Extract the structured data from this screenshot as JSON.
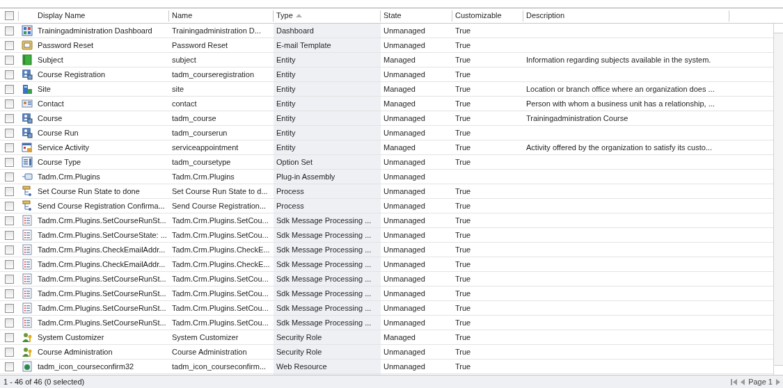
{
  "columns": [
    {
      "label": "Display Name",
      "sorted": false
    },
    {
      "label": "Name",
      "sorted": false
    },
    {
      "label": "Type",
      "sorted": true
    },
    {
      "label": "State",
      "sorted": false
    },
    {
      "label": "Customizable",
      "sorted": false
    },
    {
      "label": "Description",
      "sorted": false
    }
  ],
  "select_all": {
    "checked": false
  },
  "rows": [
    {
      "checked": false,
      "kind": "dashboard",
      "display_name": "Trainingadministration Dashboard",
      "name": "Trainingadministration D...",
      "type": "Dashboard",
      "state": "Unmanaged",
      "customizable": "True"
    },
    {
      "checked": false,
      "kind": "template",
      "display_name": "Password Reset",
      "name": "Password Reset",
      "type": "E-mail Template",
      "state": "Unmanaged",
      "customizable": "True"
    },
    {
      "checked": false,
      "kind": "book",
      "display_name": "Subject",
      "name": "subject",
      "type": "Entity",
      "state": "Managed",
      "customizable": "True",
      "description": "Information regarding subjects available in the system."
    },
    {
      "checked": false,
      "kind": "entity",
      "display_name": "Course Registration",
      "name": "tadm_courseregistration",
      "type": "Entity",
      "state": "Unmanaged",
      "customizable": "True"
    },
    {
      "checked": false,
      "kind": "building",
      "display_name": "Site",
      "name": "site",
      "type": "Entity",
      "state": "Managed",
      "customizable": "True",
      "description": "Location or branch office where an organization does ..."
    },
    {
      "checked": false,
      "kind": "card",
      "display_name": "Contact",
      "name": "contact",
      "type": "Entity",
      "state": "Managed",
      "customizable": "True",
      "description": "Person with whom a business unit has a relationship, ..."
    },
    {
      "checked": false,
      "kind": "entity",
      "display_name": "Course",
      "name": "tadm_course",
      "type": "Entity",
      "state": "Unmanaged",
      "customizable": "True",
      "description": "Trainingadministration Course"
    },
    {
      "checked": false,
      "kind": "entity",
      "display_name": "Course Run",
      "name": "tadm_courserun",
      "type": "Entity",
      "state": "Unmanaged",
      "customizable": "True"
    },
    {
      "checked": false,
      "kind": "calendar",
      "display_name": "Service Activity",
      "name": "serviceappointment",
      "type": "Entity",
      "state": "Managed",
      "customizable": "True",
      "description": "Activity offered by the organization to satisfy its custo..."
    },
    {
      "checked": false,
      "kind": "list",
      "display_name": "Course Type",
      "name": "tadm_coursetype",
      "type": "Option Set",
      "state": "Unmanaged",
      "customizable": "True"
    },
    {
      "checked": false,
      "kind": "plug",
      "display_name": "Tadm.Crm.Plugins",
      "name": "Tadm.Crm.Plugins",
      "type": "Plug-in Assembly",
      "state": "Unmanaged"
    },
    {
      "checked": false,
      "kind": "flow",
      "display_name": "Set Course Run State to done",
      "name": "Set Course Run State to d...",
      "type": "Process",
      "state": "Unmanaged",
      "customizable": "True"
    },
    {
      "checked": false,
      "kind": "flow",
      "display_name": "Send Course Registration Confirma...",
      "name": "Send Course Registration...",
      "type": "Process",
      "state": "Unmanaged",
      "customizable": "True"
    },
    {
      "checked": false,
      "kind": "doc",
      "display_name": "Tadm.Crm.Plugins.SetCourseRunSt...",
      "name": "Tadm.Crm.Plugins.SetCou...",
      "type": "Sdk Message Processing ...",
      "state": "Unmanaged",
      "customizable": "True"
    },
    {
      "checked": false,
      "kind": "doc",
      "display_name": "Tadm.Crm.Plugins.SetCourseState: ...",
      "name": "Tadm.Crm.Plugins.SetCou...",
      "type": "Sdk Message Processing ...",
      "state": "Unmanaged",
      "customizable": "True"
    },
    {
      "checked": false,
      "kind": "doc",
      "display_name": "Tadm.Crm.Plugins.CheckEmailAddr...",
      "name": "Tadm.Crm.Plugins.CheckE...",
      "type": "Sdk Message Processing ...",
      "state": "Unmanaged",
      "customizable": "True"
    },
    {
      "checked": false,
      "kind": "doc",
      "display_name": "Tadm.Crm.Plugins.CheckEmailAddr...",
      "name": "Tadm.Crm.Plugins.CheckE...",
      "type": "Sdk Message Processing ...",
      "state": "Unmanaged",
      "customizable": "True"
    },
    {
      "checked": false,
      "kind": "doc",
      "display_name": "Tadm.Crm.Plugins.SetCourseRunSt...",
      "name": "Tadm.Crm.Plugins.SetCou...",
      "type": "Sdk Message Processing ...",
      "state": "Unmanaged",
      "customizable": "True"
    },
    {
      "checked": false,
      "kind": "doc",
      "display_name": "Tadm.Crm.Plugins.SetCourseRunSt...",
      "name": "Tadm.Crm.Plugins.SetCou...",
      "type": "Sdk Message Processing ...",
      "state": "Unmanaged",
      "customizable": "True"
    },
    {
      "checked": false,
      "kind": "doc",
      "display_name": "Tadm.Crm.Plugins.SetCourseRunSt...",
      "name": "Tadm.Crm.Plugins.SetCou...",
      "type": "Sdk Message Processing ...",
      "state": "Unmanaged",
      "customizable": "True"
    },
    {
      "checked": false,
      "kind": "doc",
      "display_name": "Tadm.Crm.Plugins.SetCourseRunSt...",
      "name": "Tadm.Crm.Plugins.SetCou...",
      "type": "Sdk Message Processing ...",
      "state": "Unmanaged",
      "customizable": "True"
    },
    {
      "checked": false,
      "kind": "people",
      "display_name": "System Customizer",
      "name": "System Customizer",
      "type": "Security Role",
      "state": "Managed",
      "customizable": "True"
    },
    {
      "checked": false,
      "kind": "people",
      "display_name": "Course Administration",
      "name": "Course Administration",
      "type": "Security Role",
      "state": "Unmanaged",
      "customizable": "True"
    },
    {
      "checked": false,
      "kind": "globe",
      "display_name": "tadm_icon_courseconfirm32",
      "name": "tadm_icon_courseconfirm...",
      "type": "Web Resource",
      "state": "Unmanaged",
      "customizable": "True"
    }
  ],
  "status_bar": {
    "record_count": "1 - 46 of 46 (0 selected)",
    "page": "Page 1"
  }
}
